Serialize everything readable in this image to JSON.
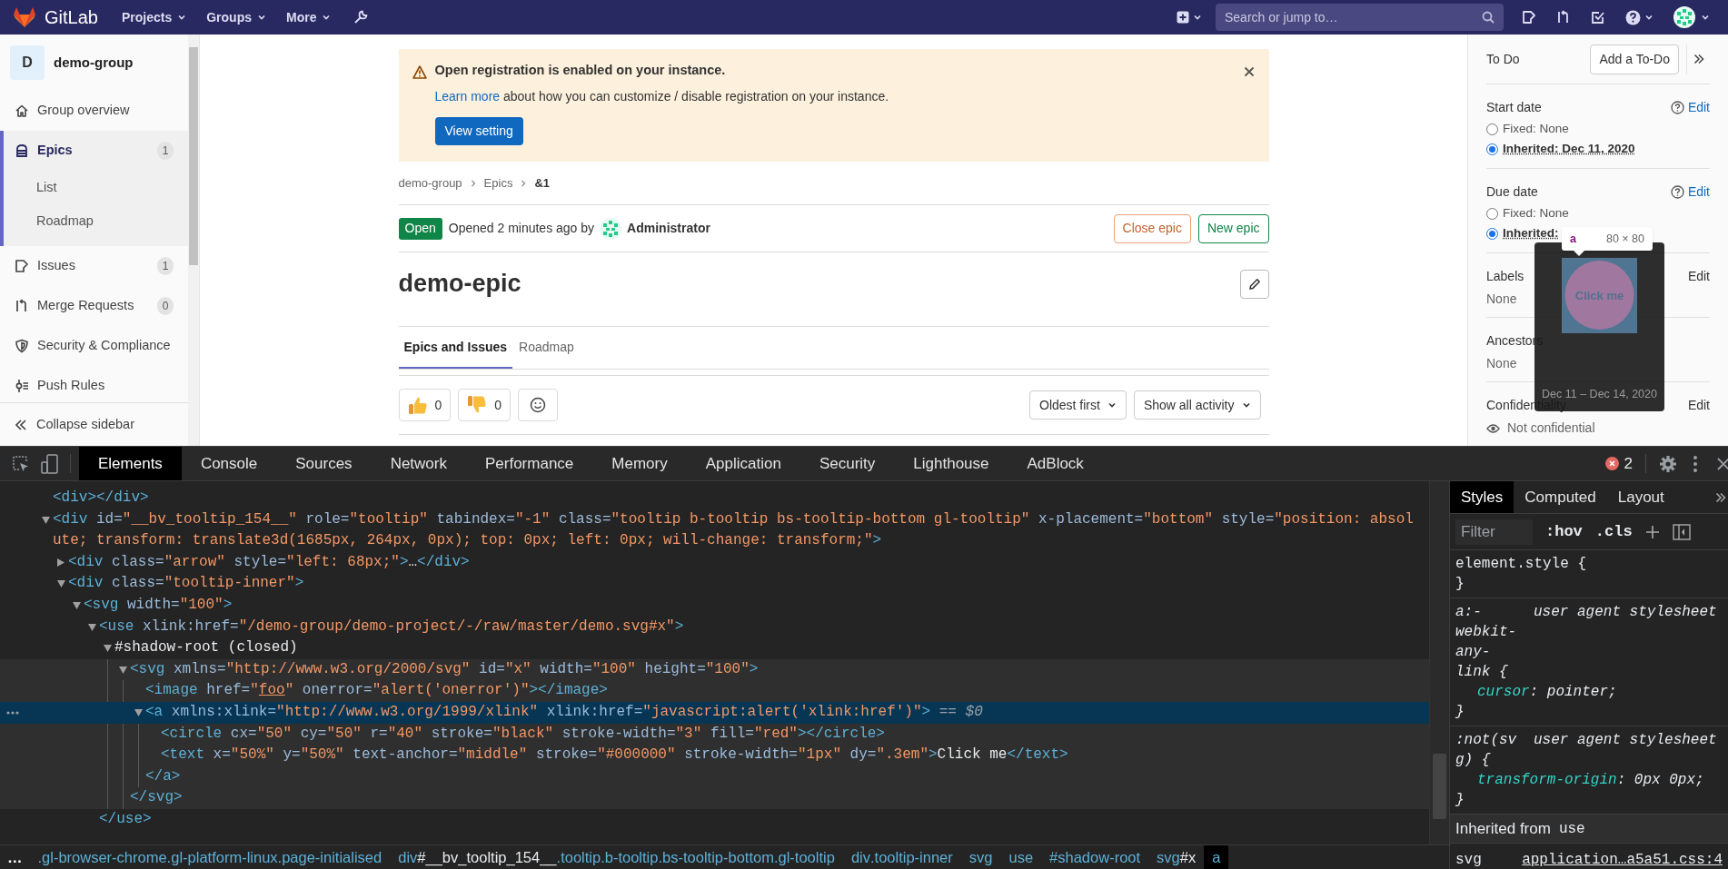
{
  "top_nav": {
    "brand": "GitLab",
    "menus": [
      {
        "label": "Projects"
      },
      {
        "label": "Groups"
      },
      {
        "label": "More"
      }
    ],
    "search": {
      "placeholder": "Search or jump to…"
    }
  },
  "sidebar": {
    "group": {
      "initial": "D",
      "name": "demo-group"
    },
    "items": [
      {
        "kind": "home",
        "label": "Group overview",
        "selected": false
      },
      {
        "kind": "epic",
        "label": "Epics",
        "count": "1",
        "selected": true,
        "children": [
          {
            "label": "List",
            "selected": false
          },
          {
            "label": "Roadmap",
            "selected": false
          }
        ]
      },
      {
        "kind": "issues",
        "label": "Issues",
        "count": "1",
        "selected": false
      },
      {
        "kind": "merge",
        "label": "Merge Requests",
        "count": "0",
        "selected": false
      },
      {
        "kind": "shield",
        "label": "Security & Compliance",
        "selected": false
      },
      {
        "kind": "push",
        "label": "Push Rules",
        "selected": false
      }
    ],
    "collapse": "Collapse sidebar"
  },
  "alert": {
    "title": "Open registration is enabled on your instance.",
    "link": "Learn more",
    "text": "about how you can customize / disable registration on your instance.",
    "button": "View setting"
  },
  "breadcrumb": [
    "demo-group",
    "Epics",
    "&1"
  ],
  "epic": {
    "status": "Open",
    "opened": "Opened 2 minutes ago by",
    "author": "Administrator",
    "actions": [
      {
        "label": "Close epic",
        "kind": "close"
      },
      {
        "label": "New epic",
        "kind": "new"
      }
    ],
    "title": "demo-epic"
  },
  "tabs": [
    {
      "label": "Epics and Issues",
      "selected": true
    },
    {
      "label": "Roadmap",
      "selected": false
    }
  ],
  "awards": [
    {
      "kind": "thumbsup",
      "count": "0"
    },
    {
      "kind": "thumbsdown",
      "count": "0"
    }
  ],
  "sort": [
    "Oldest first",
    "Show all activity"
  ],
  "right_sidebar": {
    "todo": {
      "label": "To Do",
      "button": "Add a To-Do"
    },
    "dates": [
      {
        "label": "Start date",
        "edit": "Edit",
        "options": [
          {
            "text": "Fixed: None",
            "selected": false
          },
          {
            "text": "Inherited: Dec 11, 2020",
            "selected": true
          }
        ]
      },
      {
        "label": "Due date",
        "edit": "Edit",
        "options": [
          {
            "text": "Fixed: None",
            "selected": false
          },
          {
            "text": "Inherited:",
            "selected": true
          }
        ]
      }
    ],
    "fields": [
      {
        "kind": "plain",
        "label": "Labels",
        "value": "None",
        "edit": "Edit"
      },
      {
        "kind": "plain",
        "label": "Ancestors",
        "value": "None"
      },
      {
        "kind": "eye",
        "label": "Confidentiality",
        "value": "Not confidential",
        "edit": "Edit"
      }
    ]
  },
  "tooltip": {
    "preview_text": "Click me",
    "dates": "Dec 11 – Dec 14, 2020"
  },
  "inspect_badge": {
    "tag": "a",
    "size": "80 × 80"
  },
  "devtools": {
    "tabs": [
      {
        "label": "Elements",
        "selected": true
      },
      {
        "label": "Console",
        "selected": false
      },
      {
        "label": "Sources",
        "selected": false
      },
      {
        "label": "Network",
        "selected": false
      },
      {
        "label": "Performance",
        "selected": false
      },
      {
        "label": "Memory",
        "selected": false
      },
      {
        "label": "Application",
        "selected": false
      },
      {
        "label": "Security",
        "selected": false
      },
      {
        "label": "Lighthouse",
        "selected": false
      },
      {
        "label": "AdBlock",
        "selected": false
      }
    ],
    "errors": "2",
    "dom": [
      {
        "kind": "leaf",
        "selected": false,
        "open": [
          {
            "kind": "tag",
            "text": "<div></div>"
          }
        ]
      },
      {
        "kind": "element",
        "expanded": true,
        "selected": false,
        "open": [
          {
            "kind": "tag",
            "text": "<div"
          },
          {
            "kind": "attr",
            "text": " id="
          },
          {
            "kind": "val",
            "text": "\"__bv_tooltip_154__\""
          },
          {
            "kind": "attr",
            "text": " role="
          },
          {
            "kind": "val",
            "text": "\"tooltip\""
          },
          {
            "kind": "attr",
            "text": " tabindex="
          },
          {
            "kind": "val",
            "text": "\"-1\""
          },
          {
            "kind": "attr",
            "text": " class="
          },
          {
            "kind": "val",
            "text": "\"tooltip b-tooltip bs-tooltip-bottom gl-tooltip\""
          },
          {
            "kind": "attr",
            "text": " x-placement="
          },
          {
            "kind": "val",
            "text": "\"bottom\""
          },
          {
            "kind": "attr",
            "text": " style="
          },
          {
            "kind": "val",
            "text": "\"position: absolute; transform: translate3d(1685px, 264px, 0px); top: 0px; left: 0px; will-change: transform;\""
          },
          {
            "kind": "tag",
            "text": ">"
          }
        ],
        "children": [
          {
            "kind": "element",
            "expanded": false,
            "selected": false,
            "open": [
              {
                "kind": "tag",
                "text": "<div"
              },
              {
                "kind": "attr",
                "text": " class="
              },
              {
                "kind": "val",
                "text": "\"arrow\""
              },
              {
                "kind": "attr",
                "text": " style="
              },
              {
                "kind": "val",
                "text": "\"left: 68px;\""
              },
              {
                "kind": "tag",
                "text": ">"
              },
              {
                "kind": "text",
                "text": "…"
              },
              {
                "kind": "tag",
                "text": "</div>"
              }
            ]
          },
          {
            "kind": "element",
            "expanded": true,
            "selected": false,
            "open": [
              {
                "kind": "tag",
                "text": "<div"
              },
              {
                "kind": "attr",
                "text": " class="
              },
              {
                "kind": "val",
                "text": "\"tooltip-inner\""
              },
              {
                "kind": "tag",
                "text": ">"
              }
            ],
            "children": [
              {
                "kind": "element",
                "expanded": true,
                "selected": false,
                "open": [
                  {
                    "kind": "tag",
                    "text": "<svg"
                  },
                  {
                    "kind": "attr",
                    "text": " width="
                  },
                  {
                    "kind": "val",
                    "text": "\"100\""
                  },
                  {
                    "kind": "tag",
                    "text": ">"
                  }
                ],
                "children": [
                  {
                    "kind": "element",
                    "expanded": true,
                    "selected": false,
                    "open": [
                      {
                        "kind": "tag",
                        "text": "<use"
                      },
                      {
                        "kind": "attr",
                        "text": " xlink:href="
                      },
                      {
                        "kind": "val",
                        "text": "\"/demo-group/demo-project/-/raw/master/demo.svg#x\""
                      },
                      {
                        "kind": "tag",
                        "text": ">"
                      }
                    ],
                    "children": [
                      {
                        "kind": "shadow",
                        "expanded": true,
                        "selected": false,
                        "open": [
                          {
                            "kind": "text",
                            "text": "#shadow-root (closed)"
                          }
                        ],
                        "children": [
                          {
                            "kind": "element",
                            "expanded": true,
                            "selected": false,
                            "open": [
                              {
                                "kind": "tag",
                                "text": "<svg"
                              },
                              {
                                "kind": "attr",
                                "text": " xmlns="
                              },
                              {
                                "kind": "val",
                                "text": "\"http://www.w3.org/2000/svg\""
                              },
                              {
                                "kind": "attr",
                                "text": " id="
                              },
                              {
                                "kind": "val",
                                "text": "\"x\""
                              },
                              {
                                "kind": "attr",
                                "text": " width="
                              },
                              {
                                "kind": "val",
                                "text": "\"100\""
                              },
                              {
                                "kind": "attr",
                                "text": " height="
                              },
                              {
                                "kind": "val",
                                "text": "\"100\""
                              },
                              {
                                "kind": "tag",
                                "text": ">"
                              }
                            ],
                            "children": [
                              {
                                "kind": "leaf",
                                "selected": false,
                                "open": [
                                  {
                                    "kind": "tag",
                                    "text": "<image"
                                  },
                                  {
                                    "kind": "attr",
                                    "text": " href="
                                  },
                                  {
                                    "kind": "val",
                                    "text": "\""
                                  },
                                  {
                                    "kind": "link",
                                    "text": "foo"
                                  },
                                  {
                                    "kind": "val",
                                    "text": "\""
                                  },
                                  {
                                    "kind": "attr",
                                    "text": " onerror="
                                  },
                                  {
                                    "kind": "val",
                                    "text": "\"alert('onerror')\""
                                  },
                                  {
                                    "kind": "tag",
                                    "text": "></image>"
                                  }
                                ]
                              },
                              {
                                "kind": "element",
                                "expanded": true,
                                "selected": true,
                                "open": [
                                  {
                                    "kind": "tag",
                                    "text": "<a"
                                  },
                                  {
                                    "kind": "attr",
                                    "text": " xmlns:xlink="
                                  },
                                  {
                                    "kind": "val",
                                    "text": "\"http://www.w3.org/1999/xlink\""
                                  },
                                  {
                                    "kind": "attr",
                                    "text": " xlink:href="
                                  },
                                  {
                                    "kind": "val",
                                    "text": "\"javascript:alert('xlink:href')\""
                                  },
                                  {
                                    "kind": "tag",
                                    "text": ">"
                                  },
                                  {
                                    "kind": "ref",
                                    "text": " == $0"
                                  }
                                ],
                                "children": [
                                  {
                                    "kind": "leaf",
                                    "selected": false,
                                    "open": [
                                      {
                                        "kind": "tag",
                                        "text": "<circle"
                                      },
                                      {
                                        "kind": "attr",
                                        "text": " cx="
                                      },
                                      {
                                        "kind": "val",
                                        "text": "\"50\""
                                      },
                                      {
                                        "kind": "attr",
                                        "text": " cy="
                                      },
                                      {
                                        "kind": "val",
                                        "text": "\"50\""
                                      },
                                      {
                                        "kind": "attr",
                                        "text": " r="
                                      },
                                      {
                                        "kind": "val",
                                        "text": "\"40\""
                                      },
                                      {
                                        "kind": "attr",
                                        "text": " stroke="
                                      },
                                      {
                                        "kind": "val",
                                        "text": "\"black\""
                                      },
                                      {
                                        "kind": "attr",
                                        "text": " stroke-width="
                                      },
                                      {
                                        "kind": "val",
                                        "text": "\"3\""
                                      },
                                      {
                                        "kind": "attr",
                                        "text": " fill="
                                      },
                                      {
                                        "kind": "val",
                                        "text": "\"red\""
                                      },
                                      {
                                        "kind": "tag",
                                        "text": "></circle>"
                                      }
                                    ]
                                  },
                                  {
                                    "kind": "leaf",
                                    "selected": false,
                                    "open": [
                                      {
                                        "kind": "tag",
                                        "text": "<text"
                                      },
                                      {
                                        "kind": "attr",
                                        "text": " x="
                                      },
                                      {
                                        "kind": "val",
                                        "text": "\"50%\""
                                      },
                                      {
                                        "kind": "attr",
                                        "text": " y="
                                      },
                                      {
                                        "kind": "val",
                                        "text": "\"50%\""
                                      },
                                      {
                                        "kind": "attr",
                                        "text": " text-anchor="
                                      },
                                      {
                                        "kind": "val",
                                        "text": "\"middle\""
                                      },
                                      {
                                        "kind": "attr",
                                        "text": " stroke="
                                      },
                                      {
                                        "kind": "val",
                                        "text": "\"#000000\""
                                      },
                                      {
                                        "kind": "attr",
                                        "text": " stroke-width="
                                      },
                                      {
                                        "kind": "val",
                                        "text": "\"1px\""
                                      },
                                      {
                                        "kind": "attr",
                                        "text": " dy="
                                      },
                                      {
                                        "kind": "val",
                                        "text": "\".3em\""
                                      },
                                      {
                                        "kind": "tag",
                                        "text": ">"
                                      },
                                      {
                                        "kind": "text",
                                        "text": "Click me"
                                      },
                                      {
                                        "kind": "tag",
                                        "text": "</text>"
                                      }
                                    ]
                                  }
                                ],
                                "close": [
                                  {
                                    "kind": "tag",
                                    "text": "</a>"
                                  }
                                ]
                              }
                            ],
                            "close": [
                              {
                                "kind": "tag",
                                "text": "</svg>"
                              }
                            ]
                          }
                        ]
                      }
                    ],
                    "close": [
                      {
                        "kind": "tag",
                        "text": "</use>"
                      }
                    ]
                  }
                ]
              }
            ]
          }
        ]
      }
    ],
    "crumbs_more": "…",
    "crumbs": [
      {
        "classes": ".gl-browser-chrome.gl-platform-linux.page-initialised",
        "selected": false
      },
      {
        "tag": "div",
        "id": "#__bv_tooltip_154__",
        "classes": ".tooltip.b-tooltip.bs-tooltip-bottom.gl-tooltip",
        "selected": false
      },
      {
        "tag": "div",
        "classes": ".tooltip-inner",
        "selected": false
      },
      {
        "tag": "svg",
        "selected": false
      },
      {
        "tag": "use",
        "selected": false
      },
      {
        "tag": "#shadow-root",
        "selected": false
      },
      {
        "tag": "svg",
        "id": "#x",
        "selected": false
      },
      {
        "tag": "a",
        "selected": true
      }
    ],
    "styles": {
      "tabs": [
        {
          "label": "Styles",
          "selected": true
        },
        {
          "label": "Computed",
          "selected": false
        },
        {
          "label": "Layout",
          "selected": false
        }
      ],
      "filter": {
        "placeholder": "Filter"
      },
      "toggles": [
        ":hov",
        ".cls"
      ],
      "rules": [
        {
          "kind": "inline",
          "selector": "element.style {",
          "close": "}"
        },
        {
          "kind": "ua",
          "selector": "a:-webkit-any-link {",
          "origin": "user agent stylesheet",
          "declarations": [
            [
              {
                "kind": "prop",
                "text": "cursor"
              },
              {
                "kind": "punct",
                "text": ": "
              },
              {
                "kind": "value",
                "text": "pointer;"
              }
            ]
          ],
          "close": "}"
        },
        {
          "kind": "ua",
          "selector": ":not(svg) {",
          "origin": "user agent stylesheet",
          "declarations": [
            [
              {
                "kind": "prop",
                "text": "transform-origin"
              },
              {
                "kind": "punct",
                "text": ": "
              },
              {
                "kind": "value",
                "text": "0px 0px;"
              }
            ]
          ],
          "close": "}"
        }
      ],
      "inherited": {
        "label": "Inherited from",
        "element": "use"
      },
      "author_rule": {
        "selector": "svg",
        "origin": "application…a5a51.css:4"
      }
    }
  }
}
